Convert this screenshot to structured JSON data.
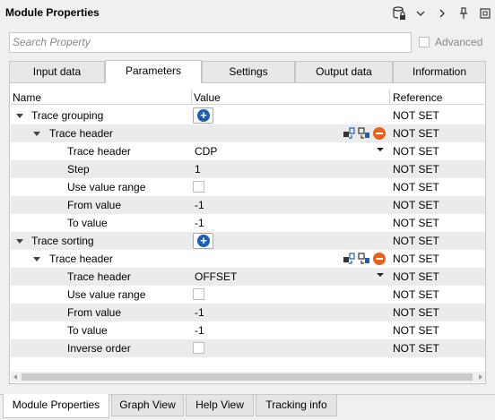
{
  "window": {
    "title": "Module Properties",
    "icons": [
      "database-lock-icon",
      "chevron-down-icon",
      "chevron-right-icon",
      "pin-icon",
      "restore-icon"
    ]
  },
  "search": {
    "placeholder": "Search Property",
    "advanced_label": "Advanced"
  },
  "tabs": [
    {
      "label": "Input data",
      "active": false
    },
    {
      "label": "Parameters",
      "active": true
    },
    {
      "label": "Settings",
      "active": false
    },
    {
      "label": "Output data",
      "active": false
    },
    {
      "label": "Information",
      "active": false
    }
  ],
  "columns": {
    "name": "Name",
    "value": "Value",
    "reference": "Reference"
  },
  "rows": [
    {
      "name": "Trace grouping",
      "level": 0,
      "expanded": true,
      "value_type": "add",
      "value": "",
      "reference": "NOT SET"
    },
    {
      "name": "Trace header",
      "level": 1,
      "expanded": true,
      "value_type": "actions",
      "value": "",
      "reference": "NOT SET"
    },
    {
      "name": "Trace header",
      "level": 2,
      "value_type": "dropdown",
      "value": "CDP",
      "reference": "NOT SET"
    },
    {
      "name": "Step",
      "level": 2,
      "value_type": "text",
      "value": "1",
      "reference": "NOT SET"
    },
    {
      "name": "Use value range",
      "level": 2,
      "value_type": "checkbox",
      "value": "",
      "reference": "NOT SET"
    },
    {
      "name": "From value",
      "level": 2,
      "value_type": "text",
      "value": "-1",
      "reference": "NOT SET"
    },
    {
      "name": "To value",
      "level": 2,
      "value_type": "text",
      "value": "-1",
      "reference": "NOT SET"
    },
    {
      "name": "Trace sorting",
      "level": 0,
      "expanded": true,
      "value_type": "add",
      "value": "",
      "reference": "NOT SET"
    },
    {
      "name": "Trace header",
      "level": 1,
      "expanded": true,
      "value_type": "actions",
      "value": "",
      "reference": "NOT SET"
    },
    {
      "name": "Trace header",
      "level": 2,
      "value_type": "dropdown",
      "value": "OFFSET",
      "reference": "NOT SET"
    },
    {
      "name": "Use value range",
      "level": 2,
      "value_type": "checkbox",
      "value": "",
      "reference": "NOT SET"
    },
    {
      "name": "From value",
      "level": 2,
      "value_type": "text",
      "value": "-1",
      "reference": "NOT SET"
    },
    {
      "name": "To value",
      "level": 2,
      "value_type": "text",
      "value": "-1",
      "reference": "NOT SET"
    },
    {
      "name": "Inverse order",
      "level": 2,
      "value_type": "checkbox",
      "value": "",
      "reference": "NOT SET"
    }
  ],
  "bottom_tabs": [
    {
      "label": "Module Properties",
      "active": true
    },
    {
      "label": "Graph View",
      "active": false
    },
    {
      "label": "Help View",
      "active": false
    },
    {
      "label": "Tracking info",
      "active": false
    }
  ],
  "colors": {
    "accent_blue": "#1a5fb4",
    "remove_orange": "#e8621b",
    "alt_row": "#ebebeb"
  }
}
